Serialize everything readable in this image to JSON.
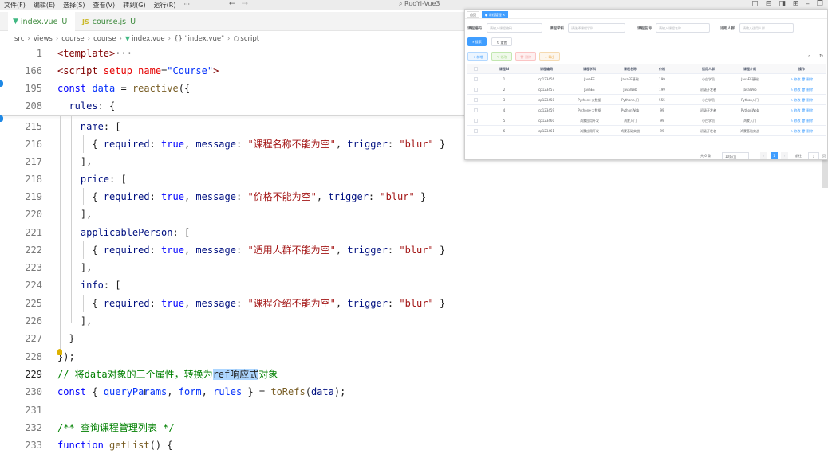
{
  "menus": [
    "文件(F)",
    "编辑(E)",
    "选择(S)",
    "查看(V)",
    "转到(G)",
    "运行(R)",
    "···"
  ],
  "window_title": "RuoYi-Vue3",
  "tabs": [
    {
      "icon": "V",
      "name": "index.vue",
      "status": "U"
    },
    {
      "icon": "JS",
      "name": "course.js",
      "status": "U"
    }
  ],
  "breadcrumb": [
    "src",
    "views",
    "course",
    "course",
    "index.vue",
    "{} \"index.vue\"",
    "script"
  ],
  "code_lines": [
    {
      "num": "1",
      "segs": [
        [
          "t",
          "<template>"
        ],
        [
          "x",
          "···"
        ]
      ]
    },
    {
      "num": "166",
      "segs": [
        [
          "t",
          "<script "
        ],
        [
          "a",
          "setup "
        ],
        [
          "a",
          "name"
        ],
        [
          "x",
          "="
        ],
        [
          "b",
          "\"Course\""
        ],
        [
          "t",
          ">"
        ]
      ]
    },
    {
      "num": "195",
      "segs": [
        [
          "k",
          "const "
        ],
        [
          "b",
          "data "
        ],
        [
          "x",
          "= "
        ],
        [
          "f",
          "reactive"
        ],
        [
          "x",
          "({"
        ]
      ]
    },
    {
      "num": "208",
      "segs": [
        [
          "x",
          "  "
        ],
        [
          "v",
          "rules"
        ],
        [
          "x",
          ": {"
        ]
      ]
    },
    {
      "num": "215",
      "segs": [
        [
          "x",
          "    "
        ],
        [
          "v",
          "name"
        ],
        [
          "x",
          ": ["
        ]
      ]
    },
    {
      "num": "216",
      "segs": [
        [
          "x",
          "      { "
        ],
        [
          "v",
          "required"
        ],
        [
          "x",
          ": "
        ],
        [
          "k",
          "true"
        ],
        [
          "x",
          ", "
        ],
        [
          "v",
          "message"
        ],
        [
          "x",
          ": "
        ],
        [
          "s",
          "\"课程名称不能为空\""
        ],
        [
          "x",
          ", "
        ],
        [
          "v",
          "trigger"
        ],
        [
          "x",
          ": "
        ],
        [
          "s",
          "\"blur\""
        ],
        [
          "x",
          " }"
        ]
      ]
    },
    {
      "num": "217",
      "segs": [
        [
          "x",
          "    ],"
        ]
      ]
    },
    {
      "num": "218",
      "segs": [
        [
          "x",
          "    "
        ],
        [
          "v",
          "price"
        ],
        [
          "x",
          ": ["
        ]
      ]
    },
    {
      "num": "219",
      "segs": [
        [
          "x",
          "      { "
        ],
        [
          "v",
          "required"
        ],
        [
          "x",
          ": "
        ],
        [
          "k",
          "true"
        ],
        [
          "x",
          ", "
        ],
        [
          "v",
          "message"
        ],
        [
          "x",
          ": "
        ],
        [
          "s",
          "\"价格不能为空\""
        ],
        [
          "x",
          ", "
        ],
        [
          "v",
          "trigger"
        ],
        [
          "x",
          ": "
        ],
        [
          "s",
          "\"blur\""
        ],
        [
          "x",
          " }"
        ]
      ]
    },
    {
      "num": "220",
      "segs": [
        [
          "x",
          "    ],"
        ]
      ]
    },
    {
      "num": "221",
      "segs": [
        [
          "x",
          "    "
        ],
        [
          "v",
          "applicablePerson"
        ],
        [
          "x",
          ": ["
        ]
      ]
    },
    {
      "num": "222",
      "segs": [
        [
          "x",
          "      { "
        ],
        [
          "v",
          "required"
        ],
        [
          "x",
          ": "
        ],
        [
          "k",
          "true"
        ],
        [
          "x",
          ", "
        ],
        [
          "v",
          "message"
        ],
        [
          "x",
          ": "
        ],
        [
          "s",
          "\"适用人群不能为空\""
        ],
        [
          "x",
          ", "
        ],
        [
          "v",
          "trigger"
        ],
        [
          "x",
          ": "
        ],
        [
          "s",
          "\"blur\""
        ],
        [
          "x",
          " }"
        ]
      ]
    },
    {
      "num": "223",
      "segs": [
        [
          "x",
          "    ],"
        ]
      ]
    },
    {
      "num": "224",
      "segs": [
        [
          "x",
          "    "
        ],
        [
          "v",
          "info"
        ],
        [
          "x",
          ": ["
        ]
      ]
    },
    {
      "num": "225",
      "segs": [
        [
          "x",
          "      { "
        ],
        [
          "v",
          "required"
        ],
        [
          "x",
          ": "
        ],
        [
          "k",
          "true"
        ],
        [
          "x",
          ", "
        ],
        [
          "v",
          "message"
        ],
        [
          "x",
          ": "
        ],
        [
          "s",
          "\"课程介绍不能为空\""
        ],
        [
          "x",
          ", "
        ],
        [
          "v",
          "trigger"
        ],
        [
          "x",
          ": "
        ],
        [
          "s",
          "\"blur\""
        ],
        [
          "x",
          " }"
        ]
      ]
    },
    {
      "num": "226",
      "segs": [
        [
          "x",
          "    ],"
        ]
      ]
    },
    {
      "num": "227",
      "segs": [
        [
          "x",
          "  }"
        ]
      ]
    },
    {
      "num": "228",
      "segs": [
        [
          "x",
          "});"
        ]
      ]
    },
    {
      "num": "229",
      "segs": [
        [
          "c",
          "// 将data对象的三个属性，转换为"
        ],
        [
          "h",
          "ref响应式"
        ],
        [
          "c",
          "对象"
        ]
      ]
    },
    {
      "num": "230",
      "segs": [
        [
          "k",
          "const "
        ],
        [
          "x",
          "{ "
        ],
        [
          "b",
          "queryParams"
        ],
        [
          "x",
          ", "
        ],
        [
          "b",
          "form"
        ],
        [
          "x",
          ", "
        ],
        [
          "b",
          "rules"
        ],
        [
          "x",
          " } = "
        ],
        [
          "f",
          "toRefs"
        ],
        [
          "x",
          "("
        ],
        [
          "v",
          "data"
        ],
        [
          "x",
          ");"
        ]
      ]
    },
    {
      "num": "231",
      "segs": []
    },
    {
      "num": "232",
      "segs": [
        [
          "c",
          "/** 查询课程管理列表 */"
        ]
      ]
    },
    {
      "num": "233",
      "segs": [
        [
          "k",
          "function "
        ],
        [
          "f",
          "getList"
        ],
        [
          "x",
          "() {"
        ]
      ]
    }
  ],
  "preview": {
    "tabs": [
      "首页",
      "● 课程管理 ×"
    ],
    "form": [
      {
        "label": "课程编码",
        "placeholder": "请输入课程编码"
      },
      {
        "label": "课程学科",
        "placeholder": "请选择课程学科"
      },
      {
        "label": "课程名称",
        "placeholder": "请输入课程名称"
      },
      {
        "label": "适用人群",
        "placeholder": "请输入适用人群"
      }
    ],
    "search_label": "搜索",
    "reset_label": "重置",
    "toolbar": [
      "新增",
      "修改",
      "删除",
      "导出"
    ],
    "headers": [
      "课程id",
      "课程编码",
      "课程学科",
      "课程名称",
      "价格",
      "适用人群",
      "课程介绍",
      "操作"
    ],
    "rows": [
      [
        "1",
        "cp123456",
        "JavaEE",
        "JavaEE基础",
        "199",
        "小白学员",
        "JavaEE基础"
      ],
      [
        "2",
        "cp123457",
        "JavaEE",
        "JavaWeb",
        "199",
        "初级开发者",
        "JavaWeb"
      ],
      [
        "3",
        "cp123458",
        "Python+大数据",
        "Python入门",
        "555",
        "小白学员",
        "Python入门"
      ],
      [
        "4",
        "cp123459",
        "Python+大数据",
        "PythonWeb",
        "99",
        "初级开发者",
        "PythonWeb"
      ],
      [
        "5",
        "cp123460",
        "鸿蒙应用开发",
        "鸿蒙入门",
        "99",
        "小白学员",
        "鸿蒙入门"
      ],
      [
        "6",
        "cp123461",
        "鸿蒙应用开发",
        "鸿蒙基础实战",
        "99",
        "初级开发者",
        "鸿蒙基础实战"
      ]
    ],
    "row_actions": [
      "修改",
      "删除"
    ],
    "pager": {
      "total": "共 6 条",
      "page_size": "10条/页",
      "current": "1",
      "goto_label": "前往",
      "goto_value": "1",
      "page_suffix": "页"
    }
  }
}
